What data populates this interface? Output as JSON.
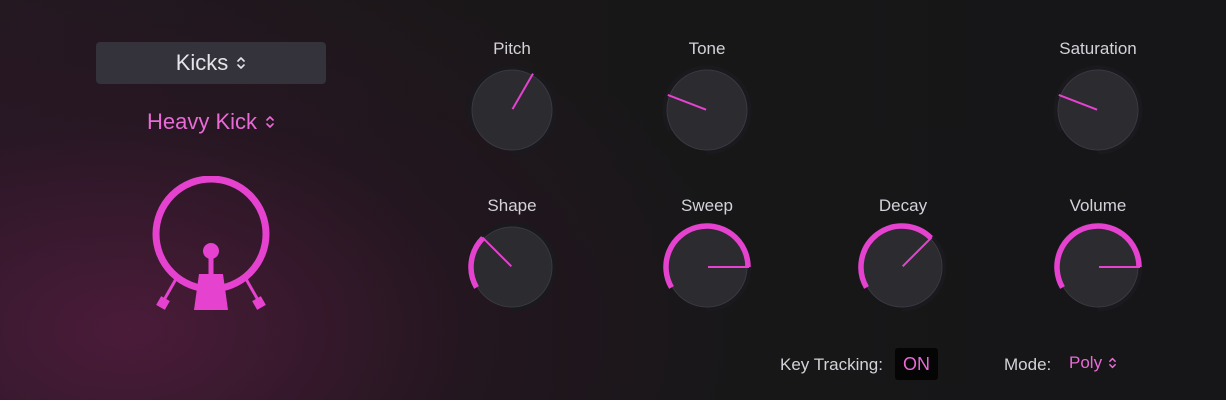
{
  "category": {
    "label": "Kicks"
  },
  "preset": {
    "label": "Heavy Kick"
  },
  "knobs": {
    "pitch": {
      "label": "Pitch",
      "value": 0.5
    },
    "tone": {
      "label": "Tone",
      "value": 0.17
    },
    "saturation": {
      "label": "Saturation",
      "value": 0.17
    },
    "shape": {
      "label": "Shape",
      "value": 0.25
    },
    "sweep": {
      "label": "Sweep",
      "value": 0.7
    },
    "decay": {
      "label": "Decay",
      "value": 0.55
    },
    "volume": {
      "label": "Volume",
      "value": 0.7
    }
  },
  "key_tracking": {
    "label": "Key Tracking:",
    "value": "ON"
  },
  "mode": {
    "label": "Mode:",
    "value": "Poly"
  },
  "colors": {
    "accent": "#e542d0",
    "accent_text": "#e96ad6",
    "knob_body": "#2c2b30",
    "track": "#1a191d"
  },
  "icons": {
    "drum": "kick-drum-icon",
    "updown": "chevron-updown-icon"
  }
}
